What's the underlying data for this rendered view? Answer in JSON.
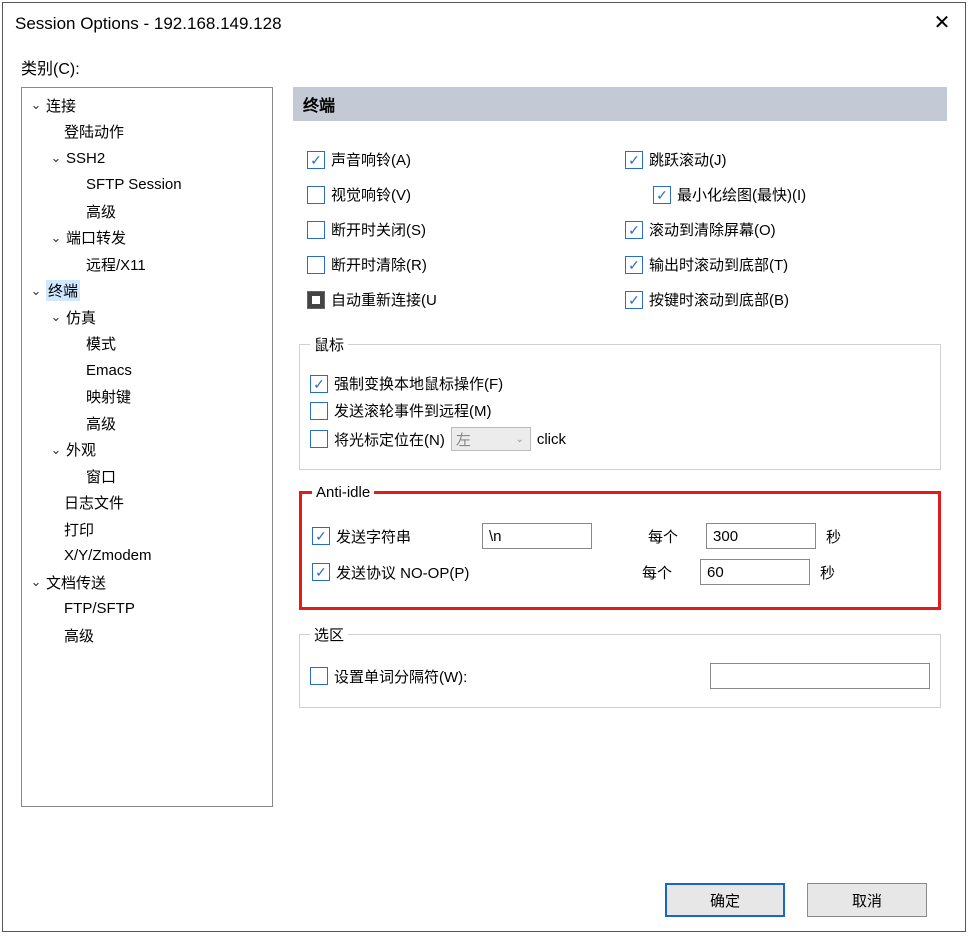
{
  "window": {
    "title": "Session Options - 192.168.149.128"
  },
  "category_label": "类别(C):",
  "tree": {
    "n0": "连接",
    "n1": "登陆动作",
    "n2": "SSH2",
    "n3": "SFTP Session",
    "n4": "高级",
    "n5": "端口转发",
    "n6": "远程/X11",
    "n7": "终端",
    "n8": "仿真",
    "n9": "模式",
    "n10": "Emacs",
    "n11": "映射键",
    "n12": "高级",
    "n13": "外观",
    "n14": "窗口",
    "n15": "日志文件",
    "n16": "打印",
    "n17": "X/Y/Zmodem",
    "n18": "文档传送",
    "n19": "FTP/SFTP",
    "n20": "高级"
  },
  "section_title": "终端",
  "checks": {
    "audio_bell": "声音响铃(A)",
    "jump_scroll": "跳跃滚动(J)",
    "visual_bell": "视觉响铃(V)",
    "min_draw": "最小化绘图(最快)(I)",
    "close_on_disc": "断开时关闭(S)",
    "clear_on_scroll": "滚动到清除屏幕(O)",
    "clear_on_disc": "断开时清除(R)",
    "scroll_bottom_out": "输出时滚动到底部(T)",
    "auto_reconnect": "自动重新连接(U",
    "scroll_bottom_key": "按键时滚动到底部(B)"
  },
  "mouse": {
    "legend": "鼠标",
    "force_local": "强制变换本地鼠标操作(F)",
    "send_wheel": "发送滚轮事件到远程(M)",
    "pos_cursor": "将光标定位在(N)",
    "pos_value": "左",
    "pos_suffix": "click"
  },
  "antiidle": {
    "legend": "Anti-idle",
    "send_string_label": "发送字符串",
    "send_string_value": "\\n",
    "every_label": "每个",
    "string_seconds": "300",
    "seconds_label": "秒",
    "send_proto_label": "发送协议 NO-OP(P)",
    "proto_seconds": "60"
  },
  "selection": {
    "legend": "选区",
    "word_delim_label": "设置单词分隔符(W):",
    "word_delim_value": ""
  },
  "buttons": {
    "ok": "确定",
    "cancel": "取消"
  }
}
